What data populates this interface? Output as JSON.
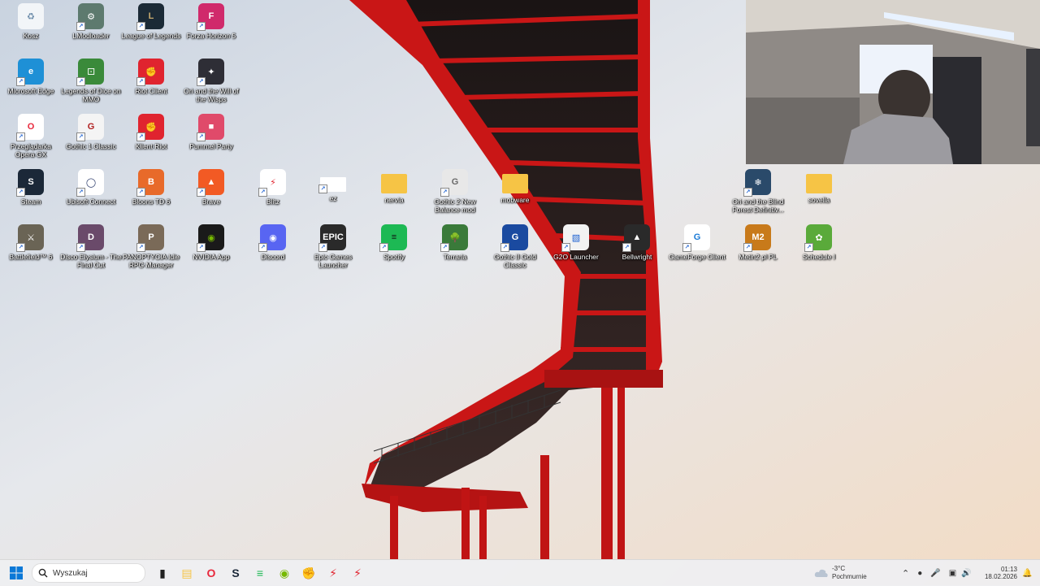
{
  "desktop": {
    "icons": [
      {
        "label": "Kosz",
        "icon": "recycle-bin-icon"
      },
      {
        "label": "LModloader",
        "icon": "modloader-icon"
      },
      {
        "label": "League of Legends",
        "icon": "league-of-legends-icon"
      },
      {
        "label": "Forza Horizon 5",
        "icon": "forza-horizon-icon"
      },
      {
        "label": "Microsoft Edge",
        "icon": "edge-icon"
      },
      {
        "label": "Legends of Dice on MMO",
        "icon": "legends-of-dice-icon"
      },
      {
        "label": "Riot Client",
        "icon": "riot-client-icon"
      },
      {
        "label": "Ori and the Will of the Wisps",
        "icon": "ori-wisps-icon"
      },
      {
        "label": "Przeglądarka Opera GX",
        "icon": "opera-gx-icon"
      },
      {
        "label": "Gothic 1 Classic",
        "icon": "gothic-classic-icon"
      },
      {
        "label": "Klient Riot",
        "icon": "riot-client-icon"
      },
      {
        "label": "Pummel Party",
        "icon": "pummel-party-icon"
      },
      {
        "label": "Steam",
        "icon": "steam-icon"
      },
      {
        "label": "Ubisoft Connect",
        "icon": "ubisoft-connect-icon"
      },
      {
        "label": "Bloons TD 6",
        "icon": "bloons-td6-icon"
      },
      {
        "label": "Brave",
        "icon": "brave-icon"
      },
      {
        "label": "Blitz",
        "icon": "blitz-icon"
      },
      {
        "label": "ez",
        "icon": "blank-file-icon"
      },
      {
        "label": "nervia",
        "icon": "folder-icon"
      },
      {
        "label": "Gothic 2 New Balance mod",
        "icon": "gothic-2-icon"
      },
      {
        "label": "mobware",
        "icon": "folder-icon"
      },
      {
        "label": "Ori and the Blind Forest Definitiv...",
        "icon": "ori-blind-forest-icon"
      },
      {
        "label": "sovella",
        "icon": "folder-icon"
      },
      {
        "label": "Battlefield™ 6",
        "icon": "battlefield-icon"
      },
      {
        "label": "Disco Elysium - The Final Cut",
        "icon": "disco-elysium-icon"
      },
      {
        "label": "PANOPTYCIA Idle RPG Manager",
        "icon": "panoptycia-icon"
      },
      {
        "label": "NVIDIA App",
        "icon": "nvidia-icon"
      },
      {
        "label": "Discord",
        "icon": "discord-icon"
      },
      {
        "label": "Epic Games Launcher",
        "icon": "epic-games-icon"
      },
      {
        "label": "Spotify",
        "icon": "spotify-icon"
      },
      {
        "label": "Terraria",
        "icon": "terraria-icon"
      },
      {
        "label": "Gothic II Gold Classic",
        "icon": "gothic-2-gold-icon"
      },
      {
        "label": "G2O Launcher",
        "icon": "g2o-launcher-icon"
      },
      {
        "label": "Bellwright",
        "icon": "bellwright-icon"
      },
      {
        "label": "GameForge Client",
        "icon": "gameforge-icon"
      },
      {
        "label": "Metin2 pl PL",
        "icon": "metin2-icon"
      },
      {
        "label": "Schedule I",
        "icon": "schedule-one-icon"
      }
    ]
  },
  "taskbar": {
    "search_placeholder": "Wyszukaj",
    "pinned": [
      "task-view-icon",
      "file-explorer-icon",
      "opera-gx-icon",
      "steam-icon",
      "spotify-icon",
      "nvidia-icon",
      "riot-client-icon",
      "blitz-icon",
      "blitz-icon"
    ],
    "weather_temp": "-3°C",
    "weather_desc": "Pochmurnie",
    "time": "01:13",
    "date": "18.02.2026"
  },
  "colors": {
    "bridge_red": "#c91616",
    "taskbar_bg": "#eeeef0",
    "start_blue": "#0a78d7"
  }
}
